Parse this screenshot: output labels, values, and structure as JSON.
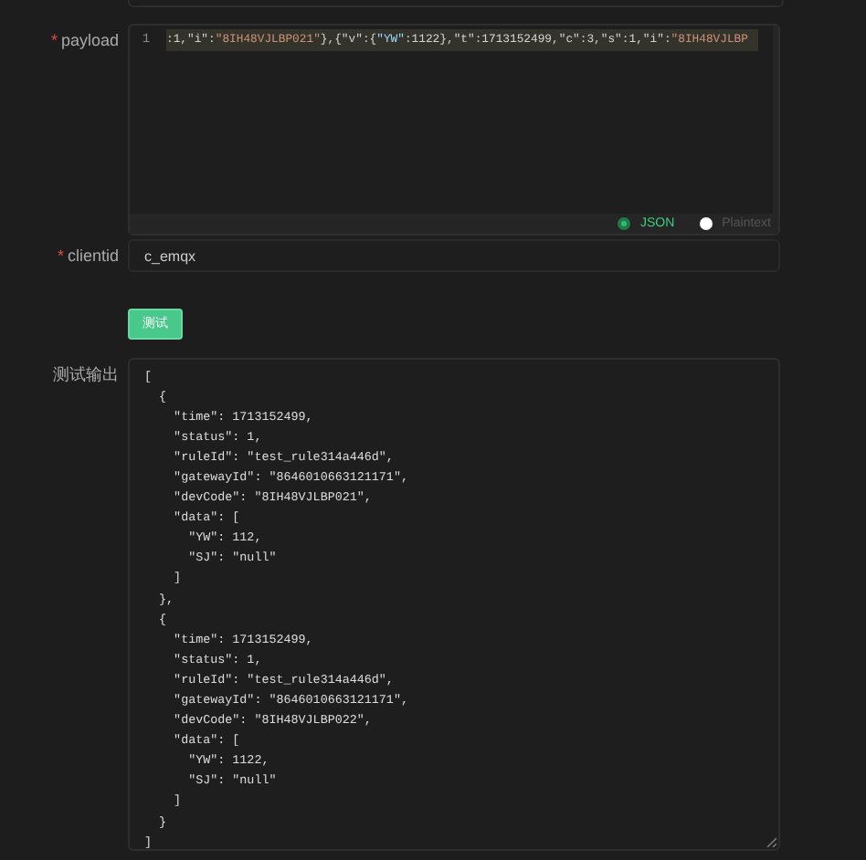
{
  "payload": {
    "label": "payload",
    "required_mark": "*",
    "line_number": "1",
    "code": [
      {
        "kind": "plain",
        "text": ":1,"
      },
      {
        "kind": "key",
        "text": "\"i\""
      },
      {
        "kind": "plain",
        "text": ":"
      },
      {
        "kind": "string",
        "text": "\"8IH48VJLBP021\""
      },
      {
        "kind": "plain",
        "text": "},{"
      },
      {
        "kind": "key",
        "text": "\"v\""
      },
      {
        "kind": "plain",
        "text": ":{"
      },
      {
        "kind": "nested",
        "text": "\"YW\""
      },
      {
        "kind": "plain",
        "text": ":1122},"
      },
      {
        "kind": "key",
        "text": "\"t\""
      },
      {
        "kind": "plain",
        "text": ":1713152499,"
      },
      {
        "kind": "key",
        "text": "\"c\""
      },
      {
        "kind": "plain",
        "text": ":3,"
      },
      {
        "kind": "key",
        "text": "\"s\""
      },
      {
        "kind": "plain",
        "text": ":1,"
      },
      {
        "kind": "key",
        "text": "\"i\""
      },
      {
        "kind": "plain",
        "text": ":"
      },
      {
        "kind": "string",
        "text": "\"8IH48VJLBP"
      }
    ],
    "formats": [
      {
        "label": "JSON",
        "selected": true
      },
      {
        "label": "Plaintext",
        "selected": false
      }
    ]
  },
  "clientid": {
    "label": "clientid",
    "required_mark": "*",
    "value": "c_emqx"
  },
  "test_button": "测试",
  "output": {
    "label": "测试输出",
    "lines": [
      "[",
      "  {",
      "    \"time\": 1713152499,",
      "    \"status\": 1,",
      "    \"ruleId\": \"test_rule314a446d\",",
      "    \"gatewayId\": \"8646010663121171\",",
      "    \"devCode\": \"8IH48VJLBP021\",",
      "    \"data\": [",
      "      \"YW\": 112,",
      "      \"SJ\": \"null\"",
      "    ]",
      "  },",
      "  {",
      "    \"time\": 1713152499,",
      "    \"status\": 1,",
      "    \"ruleId\": \"test_rule314a446d\",",
      "    \"gatewayId\": \"8646010663121171\",",
      "    \"devCode\": \"8IH48VJLBP022\",",
      "    \"data\": [",
      "      \"YW\": 1122,",
      "      \"SJ\": \"null\"",
      "    ]",
      "  }",
      "]"
    ]
  }
}
